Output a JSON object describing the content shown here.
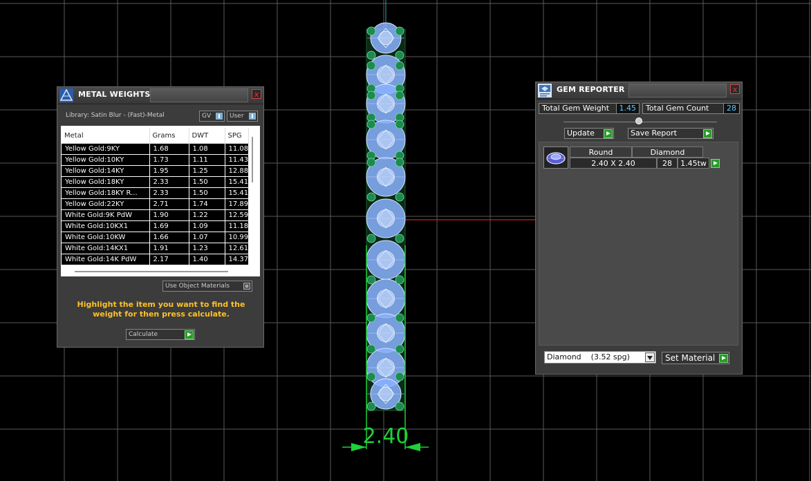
{
  "viewport": {
    "dimension_label": "2.40",
    "grid_color": "#5a5a5a",
    "gem_color": "#8ab2ff",
    "prong_color": "#1d8a4e",
    "dimension_color": "#1fd13a",
    "axis_color": "#d02020"
  },
  "metal_weights": {
    "title": "METAL WEIGHTS",
    "library_label": "Library: Satin Blur - (Fast)-Metal",
    "toggle_gv": "GV",
    "toggle_user": "User",
    "columns": [
      "Metal",
      "Grams",
      "DWT",
      "SPG"
    ],
    "rows": [
      [
        "Yellow Gold:9KY",
        "1.68",
        "1.08",
        "11.08"
      ],
      [
        "Yellow Gold:10KY",
        "1.73",
        "1.11",
        "11.43"
      ],
      [
        "Yellow Gold:14KY",
        "1.95",
        "1.25",
        "12.88"
      ],
      [
        "Yellow Gold:18KY",
        "2.33",
        "1.50",
        "15.41"
      ],
      [
        "Yellow Gold:18KY R...",
        "2.33",
        "1.50",
        "15.41"
      ],
      [
        "Yellow Gold:22KY",
        "2.71",
        "1.74",
        "17.89"
      ],
      [
        "White Gold:9K PdW",
        "1.90",
        "1.22",
        "12.59"
      ],
      [
        "White Gold:10KX1",
        "1.69",
        "1.09",
        "11.18"
      ],
      [
        "White Gold:10KW",
        "1.66",
        "1.07",
        "10.99"
      ],
      [
        "White Gold:14KX1",
        "1.91",
        "1.23",
        "12.61"
      ],
      [
        "White Gold:14K PdW",
        "2.17",
        "1.40",
        "14.37"
      ]
    ],
    "use_object_materials": "Use Object Materials",
    "hint": "Highlight the item you want to find the weight for then press calculate.",
    "calculate": "Calculate",
    "close": "x"
  },
  "gem_reporter": {
    "title": "GEM REPORTER",
    "total_gem_weight_label": "Total Gem Weight",
    "total_gem_weight": "1.45",
    "total_gem_count_label": "Total Gem Count",
    "total_gem_count": "28",
    "update": "Update",
    "save_report": "Save Report",
    "gem_row": {
      "shape": "Round",
      "material": "Diamond",
      "size": "2.40 X 2.40",
      "count": "28",
      "weight": "1.45tw"
    },
    "material_select": "Diamond    (3.52 spg)",
    "set_material": "Set Material",
    "close": "x"
  }
}
